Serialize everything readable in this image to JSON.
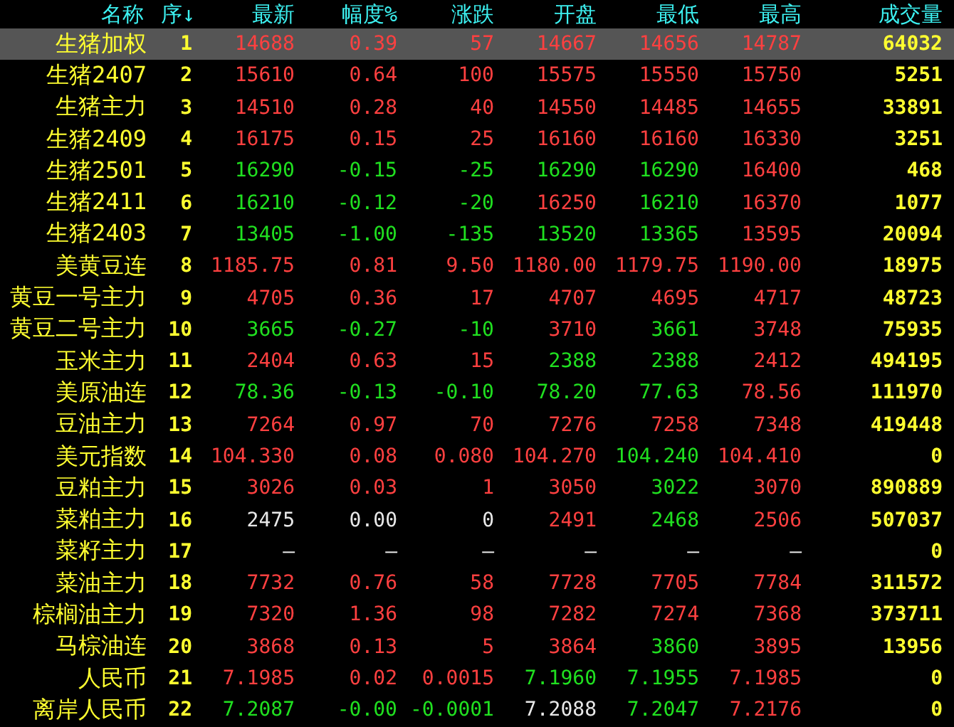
{
  "columns": [
    "名称",
    "序↓",
    "最新",
    "幅度%",
    "涨跌",
    "开盘",
    "最低",
    "最高",
    "成交量"
  ],
  "rows": [
    {
      "name": "生猪加权",
      "seq": "1",
      "selected": true,
      "quotes": [
        {
          "text": "14688",
          "color": "#ff4040"
        },
        {
          "text": "0.39",
          "color": "#ff4040"
        },
        {
          "text": "57",
          "color": "#ff4040"
        },
        {
          "text": "14667",
          "color": "#ff4040"
        },
        {
          "text": "14656",
          "color": "#ff4040"
        },
        {
          "text": "14787",
          "color": "#ff4040"
        }
      ],
      "volume": "64032"
    },
    {
      "name": "生猪2407",
      "seq": "2",
      "selected": false,
      "quotes": [
        {
          "text": "15610",
          "color": "#ff4040"
        },
        {
          "text": "0.64",
          "color": "#ff4040"
        },
        {
          "text": "100",
          "color": "#ff4040"
        },
        {
          "text": "15575",
          "color": "#ff4040"
        },
        {
          "text": "15550",
          "color": "#ff4040"
        },
        {
          "text": "15750",
          "color": "#ff4040"
        }
      ],
      "volume": "5251"
    },
    {
      "name": "生猪主力",
      "seq": "3",
      "selected": false,
      "quotes": [
        {
          "text": "14510",
          "color": "#ff4040"
        },
        {
          "text": "0.28",
          "color": "#ff4040"
        },
        {
          "text": "40",
          "color": "#ff4040"
        },
        {
          "text": "14550",
          "color": "#ff4040"
        },
        {
          "text": "14485",
          "color": "#ff4040"
        },
        {
          "text": "14655",
          "color": "#ff4040"
        }
      ],
      "volume": "33891"
    },
    {
      "name": "生猪2409",
      "seq": "4",
      "selected": false,
      "quotes": [
        {
          "text": "16175",
          "color": "#ff4040"
        },
        {
          "text": "0.15",
          "color": "#ff4040"
        },
        {
          "text": "25",
          "color": "#ff4040"
        },
        {
          "text": "16160",
          "color": "#ff4040"
        },
        {
          "text": "16160",
          "color": "#ff4040"
        },
        {
          "text": "16330",
          "color": "#ff4040"
        }
      ],
      "volume": "3251"
    },
    {
      "name": "生猪2501",
      "seq": "5",
      "selected": false,
      "quotes": [
        {
          "text": "16290",
          "color": "#20e020"
        },
        {
          "text": "-0.15",
          "color": "#20e020"
        },
        {
          "text": "-25",
          "color": "#20e020"
        },
        {
          "text": "16290",
          "color": "#20e020"
        },
        {
          "text": "16290",
          "color": "#20e020"
        },
        {
          "text": "16400",
          "color": "#ff4040"
        }
      ],
      "volume": "468"
    },
    {
      "name": "生猪2411",
      "seq": "6",
      "selected": false,
      "quotes": [
        {
          "text": "16210",
          "color": "#20e020"
        },
        {
          "text": "-0.12",
          "color": "#20e020"
        },
        {
          "text": "-20",
          "color": "#20e020"
        },
        {
          "text": "16250",
          "color": "#ff4040"
        },
        {
          "text": "16210",
          "color": "#20e020"
        },
        {
          "text": "16370",
          "color": "#ff4040"
        }
      ],
      "volume": "1077"
    },
    {
      "name": "生猪2403",
      "seq": "7",
      "selected": false,
      "quotes": [
        {
          "text": "13405",
          "color": "#20e020"
        },
        {
          "text": "-1.00",
          "color": "#20e020"
        },
        {
          "text": "-135",
          "color": "#20e020"
        },
        {
          "text": "13520",
          "color": "#20e020"
        },
        {
          "text": "13365",
          "color": "#20e020"
        },
        {
          "text": "13595",
          "color": "#ff4040"
        }
      ],
      "volume": "20094"
    },
    {
      "name": "美黄豆连",
      "seq": "8",
      "selected": false,
      "quotes": [
        {
          "text": "1185.75",
          "color": "#ff4040"
        },
        {
          "text": "0.81",
          "color": "#ff4040"
        },
        {
          "text": "9.50",
          "color": "#ff4040"
        },
        {
          "text": "1180.00",
          "color": "#ff4040"
        },
        {
          "text": "1179.75",
          "color": "#ff4040"
        },
        {
          "text": "1190.00",
          "color": "#ff4040"
        }
      ],
      "volume": "18975"
    },
    {
      "name": "黄豆一号主力",
      "seq": "9",
      "selected": false,
      "quotes": [
        {
          "text": "4705",
          "color": "#ff4040"
        },
        {
          "text": "0.36",
          "color": "#ff4040"
        },
        {
          "text": "17",
          "color": "#ff4040"
        },
        {
          "text": "4707",
          "color": "#ff4040"
        },
        {
          "text": "4695",
          "color": "#ff4040"
        },
        {
          "text": "4717",
          "color": "#ff4040"
        }
      ],
      "volume": "48723"
    },
    {
      "name": "黄豆二号主力",
      "seq": "10",
      "selected": false,
      "quotes": [
        {
          "text": "3665",
          "color": "#20e020"
        },
        {
          "text": "-0.27",
          "color": "#20e020"
        },
        {
          "text": "-10",
          "color": "#20e020"
        },
        {
          "text": "3710",
          "color": "#ff4040"
        },
        {
          "text": "3661",
          "color": "#20e020"
        },
        {
          "text": "3748",
          "color": "#ff4040"
        }
      ],
      "volume": "75935"
    },
    {
      "name": "玉米主力",
      "seq": "11",
      "selected": false,
      "quotes": [
        {
          "text": "2404",
          "color": "#ff4040"
        },
        {
          "text": "0.63",
          "color": "#ff4040"
        },
        {
          "text": "15",
          "color": "#ff4040"
        },
        {
          "text": "2388",
          "color": "#20e020"
        },
        {
          "text": "2388",
          "color": "#20e020"
        },
        {
          "text": "2412",
          "color": "#ff4040"
        }
      ],
      "volume": "494195"
    },
    {
      "name": "美原油连",
      "seq": "12",
      "selected": false,
      "quotes": [
        {
          "text": "78.36",
          "color": "#20e020"
        },
        {
          "text": "-0.13",
          "color": "#20e020"
        },
        {
          "text": "-0.10",
          "color": "#20e020"
        },
        {
          "text": "78.20",
          "color": "#20e020"
        },
        {
          "text": "77.63",
          "color": "#20e020"
        },
        {
          "text": "78.56",
          "color": "#ff4040"
        }
      ],
      "volume": "111970"
    },
    {
      "name": "豆油主力",
      "seq": "13",
      "selected": false,
      "quotes": [
        {
          "text": "7264",
          "color": "#ff4040"
        },
        {
          "text": "0.97",
          "color": "#ff4040"
        },
        {
          "text": "70",
          "color": "#ff4040"
        },
        {
          "text": "7276",
          "color": "#ff4040"
        },
        {
          "text": "7258",
          "color": "#ff4040"
        },
        {
          "text": "7348",
          "color": "#ff4040"
        }
      ],
      "volume": "419448"
    },
    {
      "name": "美元指数",
      "seq": "14",
      "selected": false,
      "quotes": [
        {
          "text": "104.330",
          "color": "#ff4040"
        },
        {
          "text": "0.08",
          "color": "#ff4040"
        },
        {
          "text": "0.080",
          "color": "#ff4040"
        },
        {
          "text": "104.270",
          "color": "#ff4040"
        },
        {
          "text": "104.240",
          "color": "#20e020"
        },
        {
          "text": "104.410",
          "color": "#ff4040"
        }
      ],
      "volume": "0"
    },
    {
      "name": "豆粕主力",
      "seq": "15",
      "selected": false,
      "quotes": [
        {
          "text": "3026",
          "color": "#ff4040"
        },
        {
          "text": "0.03",
          "color": "#ff4040"
        },
        {
          "text": "1",
          "color": "#ff4040"
        },
        {
          "text": "3050",
          "color": "#ff4040"
        },
        {
          "text": "3022",
          "color": "#20e020"
        },
        {
          "text": "3070",
          "color": "#ff4040"
        }
      ],
      "volume": "890889"
    },
    {
      "name": "菜粕主力",
      "seq": "16",
      "selected": false,
      "quotes": [
        {
          "text": "2475",
          "color": "#e8e8e8"
        },
        {
          "text": "0.00",
          "color": "#e8e8e8"
        },
        {
          "text": "0",
          "color": "#e8e8e8"
        },
        {
          "text": "2491",
          "color": "#ff4040"
        },
        {
          "text": "2468",
          "color": "#20e020"
        },
        {
          "text": "2506",
          "color": "#ff4040"
        }
      ],
      "volume": "507037"
    },
    {
      "name": "菜籽主力",
      "seq": "17",
      "selected": false,
      "quotes": [
        {
          "text": "—",
          "color": "#e8e8e8"
        },
        {
          "text": "—",
          "color": "#e8e8e8"
        },
        {
          "text": "—",
          "color": "#e8e8e8"
        },
        {
          "text": "—",
          "color": "#e8e8e8"
        },
        {
          "text": "—",
          "color": "#e8e8e8"
        },
        {
          "text": "—",
          "color": "#e8e8e8"
        }
      ],
      "volume": "0"
    },
    {
      "name": "菜油主力",
      "seq": "18",
      "selected": false,
      "quotes": [
        {
          "text": "7732",
          "color": "#ff4040"
        },
        {
          "text": "0.76",
          "color": "#ff4040"
        },
        {
          "text": "58",
          "color": "#ff4040"
        },
        {
          "text": "7728",
          "color": "#ff4040"
        },
        {
          "text": "7705",
          "color": "#ff4040"
        },
        {
          "text": "7784",
          "color": "#ff4040"
        }
      ],
      "volume": "311572"
    },
    {
      "name": "棕榈油主力",
      "seq": "19",
      "selected": false,
      "quotes": [
        {
          "text": "7320",
          "color": "#ff4040"
        },
        {
          "text": "1.36",
          "color": "#ff4040"
        },
        {
          "text": "98",
          "color": "#ff4040"
        },
        {
          "text": "7282",
          "color": "#ff4040"
        },
        {
          "text": "7274",
          "color": "#ff4040"
        },
        {
          "text": "7368",
          "color": "#ff4040"
        }
      ],
      "volume": "373711"
    },
    {
      "name": "马棕油连",
      "seq": "20",
      "selected": false,
      "quotes": [
        {
          "text": "3868",
          "color": "#ff4040"
        },
        {
          "text": "0.13",
          "color": "#ff4040"
        },
        {
          "text": "5",
          "color": "#ff4040"
        },
        {
          "text": "3864",
          "color": "#ff4040"
        },
        {
          "text": "3860",
          "color": "#20e020"
        },
        {
          "text": "3895",
          "color": "#ff4040"
        }
      ],
      "volume": "13956"
    },
    {
      "name": "人民币",
      "seq": "21",
      "selected": false,
      "quotes": [
        {
          "text": "7.1985",
          "color": "#ff4040"
        },
        {
          "text": "0.02",
          "color": "#ff4040"
        },
        {
          "text": "0.0015",
          "color": "#ff4040"
        },
        {
          "text": "7.1960",
          "color": "#20e020"
        },
        {
          "text": "7.1955",
          "color": "#20e020"
        },
        {
          "text": "7.1985",
          "color": "#ff4040"
        }
      ],
      "volume": "0"
    },
    {
      "name": "离岸人民币",
      "seq": "22",
      "selected": false,
      "quotes": [
        {
          "text": "7.2087",
          "color": "#20e020"
        },
        {
          "text": "-0.00",
          "color": "#20e020"
        },
        {
          "text": "-0.0001",
          "color": "#20e020"
        },
        {
          "text": "7.2088",
          "color": "#e8e8e8"
        },
        {
          "text": "7.2047",
          "color": "#20e020"
        },
        {
          "text": "7.2176",
          "color": "#ff4040"
        }
      ],
      "volume": "0"
    }
  ]
}
